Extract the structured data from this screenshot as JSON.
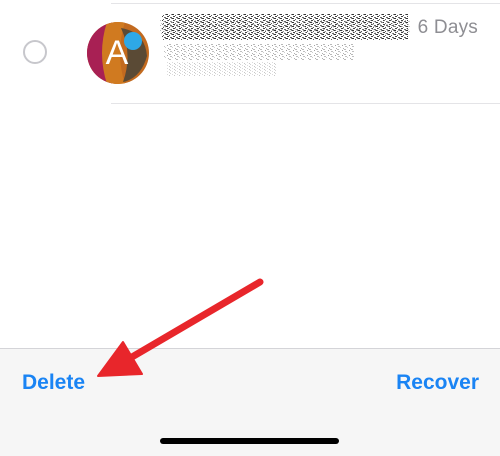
{
  "message_row": {
    "avatar_letter": "A",
    "time_remaining": "6 Days",
    "sender_redacted": true
  },
  "toolbar": {
    "delete_label": "Delete",
    "recover_label": "Recover"
  },
  "colors": {
    "accent": "#1a84f4",
    "annotation_arrow": "#e8262b",
    "secondary_text": "#8e8e93",
    "toolbar_background": "#f6f6f6"
  },
  "icons": {
    "select_indicator": "select-circle-icon",
    "annotation": "red-arrow-annotation"
  }
}
